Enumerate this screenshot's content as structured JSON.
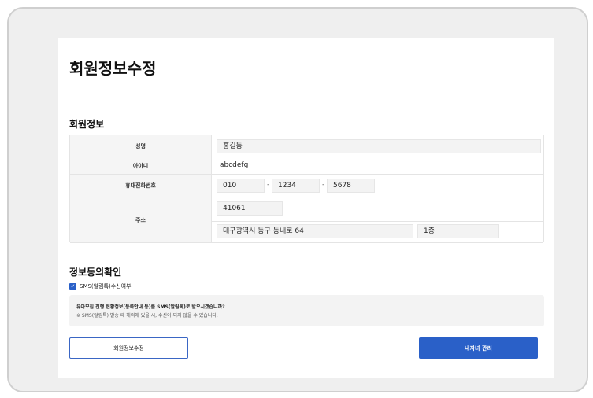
{
  "page": {
    "title": "회원정보수정"
  },
  "member_info": {
    "section_title": "회원정보",
    "name_label": "성명",
    "name_value": "홍길동",
    "id_label": "아이디",
    "id_value": "abcdefg",
    "phone_label": "휴대전화번호",
    "phone_1": "010",
    "phone_2": "1234",
    "phone_3": "5678",
    "phone_separator": "-",
    "address_label": "주소",
    "zipcode": "41061",
    "address_main": "대구광역시 동구 동내로 64",
    "address_detail": "1층"
  },
  "consent": {
    "section_title": "정보동의확인",
    "sms_checkbox_label": "SMS(알림톡)수신여부",
    "sms_checked": true,
    "notice_question": "유아모집 진행 현황정보(등록안내 등)를 SMS(알림톡)로 받으시겠습니까?",
    "notice_note": "※ SMS(알림톡) 발송 때 해외에 있을 시, 수신이 되지 않을 수 있습니다."
  },
  "buttons": {
    "edit_label": "회원정보수정",
    "manage_label": "내자녀 관리"
  },
  "colors": {
    "accent": "#2a60c8",
    "panel_bg": "#ffffff",
    "frame_bg": "#efefef"
  }
}
